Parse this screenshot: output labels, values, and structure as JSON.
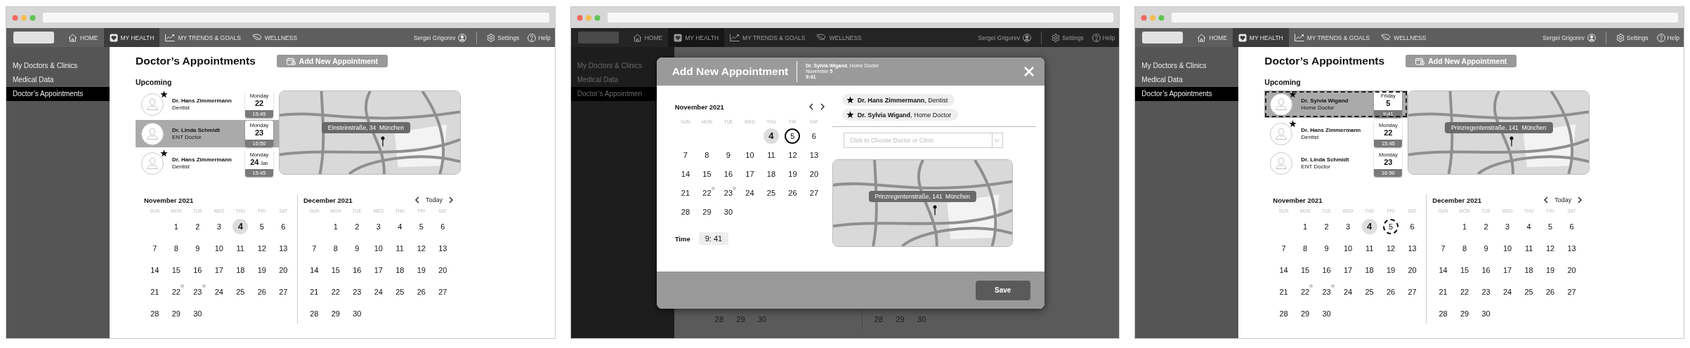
{
  "screens": [
    {
      "kind": "main",
      "dimmed": false,
      "nav": {
        "items": [
          {
            "label": "HOME",
            "selected": false
          },
          {
            "label": "MY HEALTH",
            "selected": true
          },
          {
            "label": "MY TRENDS & GOALS",
            "selected": false
          },
          {
            "label": "WELLNESS",
            "selected": false
          }
        ],
        "user": "Sergei Grigorev",
        "settings": "Settings",
        "help": "Help"
      },
      "sidebar": {
        "items": [
          {
            "label": "My Doctors & Clinics",
            "selected": false
          },
          {
            "label": "Medical Data",
            "selected": false
          },
          {
            "label": "Doctor’s Appointments",
            "selected": true
          }
        ]
      },
      "content": {
        "title": "Doctor’s Appointments",
        "add_button": "Add New Appointment",
        "upcoming_label": "Upcoming",
        "appointments": [
          {
            "name": "Dr. Hans Zimmermann",
            "specialty": "Dentist",
            "weekday": "Monday",
            "day": "22",
            "time": "15:45",
            "starred": true,
            "selected": false,
            "tentative": false
          },
          {
            "name": "Dr. Linda Schmidt",
            "specialty": "ENT Doctor",
            "weekday": "Monday",
            "day": "23",
            "time": "16:50",
            "starred": false,
            "selected": true,
            "tentative": false
          },
          {
            "name": "Dr. Hans Zimmermann",
            "specialty": "Dentist",
            "weekday": "Monday",
            "day": "24",
            "month": "Jan",
            "time": "15:45",
            "starred": true,
            "selected": false,
            "tentative": false
          }
        ],
        "map": {
          "address": "Einsteinstraße, 34  München"
        },
        "today_button": "Today",
        "calendars": [
          {
            "title": "November 2021",
            "weekdays": [
              "SUN",
              "MON",
              "TUE",
              "WED",
              "THU",
              "FRI",
              "SAT"
            ],
            "weeks": [
              {
                "days": [
                  {
                    "label": "1",
                    "today": false,
                    "event": false,
                    "selected": false
                  },
                  {
                    "label": "2",
                    "today": false,
                    "event": false,
                    "selected": false
                  },
                  {
                    "label": "3",
                    "today": false,
                    "event": false,
                    "selected": false
                  },
                  {
                    "label": "4",
                    "today": true,
                    "event": false,
                    "selected": false
                  },
                  {
                    "label": "5",
                    "today": false,
                    "event": false,
                    "selected": false
                  },
                  {
                    "label": "6",
                    "today": false,
                    "event": false,
                    "selected": false
                  }
                ]
              },
              {
                "days": [
                  {
                    "label": "7",
                    "today": false,
                    "event": false,
                    "selected": false
                  },
                  {
                    "label": "8",
                    "today": false,
                    "event": false,
                    "selected": false
                  },
                  {
                    "label": "9",
                    "today": false,
                    "event": false,
                    "selected": false
                  },
                  {
                    "label": "10",
                    "today": false,
                    "event": false,
                    "selected": false
                  },
                  {
                    "label": "11",
                    "today": false,
                    "event": false,
                    "selected": false
                  },
                  {
                    "label": "12",
                    "today": false,
                    "event": false,
                    "selected": false
                  },
                  {
                    "label": "13",
                    "today": false,
                    "event": false,
                    "selected": false
                  }
                ]
              },
              {
                "days": [
                  {
                    "label": "14",
                    "today": false,
                    "event": false,
                    "selected": false
                  },
                  {
                    "label": "15",
                    "today": false,
                    "event": false,
                    "selected": false
                  },
                  {
                    "label": "16",
                    "today": false,
                    "event": false,
                    "selected": false
                  },
                  {
                    "label": "17",
                    "today": false,
                    "event": false,
                    "selected": false
                  },
                  {
                    "label": "18",
                    "today": false,
                    "event": false,
                    "selected": false
                  },
                  {
                    "label": "19",
                    "today": false,
                    "event": false,
                    "selected": false
                  },
                  {
                    "label": "20",
                    "today": false,
                    "event": false,
                    "selected": false
                  }
                ]
              },
              {
                "days": [
                  {
                    "label": "21",
                    "today": false,
                    "event": false,
                    "selected": false
                  },
                  {
                    "label": "22",
                    "today": false,
                    "event": true,
                    "selected": false
                  },
                  {
                    "label": "23",
                    "today": false,
                    "event": true,
                    "selected": false
                  },
                  {
                    "label": "24",
                    "today": false,
                    "event": false,
                    "selected": false
                  },
                  {
                    "label": "25",
                    "today": false,
                    "event": false,
                    "selected": false
                  },
                  {
                    "label": "26",
                    "today": false,
                    "event": false,
                    "selected": false
                  },
                  {
                    "label": "27",
                    "today": false,
                    "event": false,
                    "selected": false
                  }
                ]
              },
              {
                "days": [
                  {
                    "label": "28",
                    "today": false,
                    "event": false,
                    "selected": false
                  },
                  {
                    "label": "29",
                    "today": false,
                    "event": false,
                    "selected": false
                  },
                  {
                    "label": "30",
                    "today": false,
                    "event": false,
                    "selected": false
                  }
                ]
              }
            ]
          },
          {
            "title": "December 2021",
            "weekdays": [
              "SUN",
              "MON",
              "TUE",
              "WED",
              "THU",
              "FRI",
              "SAT"
            ],
            "weeks": [
              {
                "days": [
                  {
                    "label": "1",
                    "today": false,
                    "event": false,
                    "selected": false
                  },
                  {
                    "label": "2",
                    "today": false,
                    "event": false,
                    "selected": false
                  },
                  {
                    "label": "3",
                    "today": false,
                    "event": false,
                    "selected": false
                  },
                  {
                    "label": "4",
                    "today": false,
                    "event": false,
                    "selected": false
                  },
                  {
                    "label": "5",
                    "today": false,
                    "event": false,
                    "selected": false
                  },
                  {
                    "label": "6",
                    "today": false,
                    "event": false,
                    "selected": false
                  }
                ]
              },
              {
                "days": [
                  {
                    "label": "7",
                    "today": false,
                    "event": false,
                    "selected": false
                  },
                  {
                    "label": "8",
                    "today": false,
                    "event": false,
                    "selected": false
                  },
                  {
                    "label": "9",
                    "today": false,
                    "event": false,
                    "selected": false
                  },
                  {
                    "label": "10",
                    "today": false,
                    "event": false,
                    "selected": false
                  },
                  {
                    "label": "11",
                    "today": false,
                    "event": false,
                    "selected": false
                  },
                  {
                    "label": "12",
                    "today": false,
                    "event": false,
                    "selected": false
                  },
                  {
                    "label": "13",
                    "today": false,
                    "event": false,
                    "selected": false
                  }
                ]
              },
              {
                "days": [
                  {
                    "label": "14",
                    "today": false,
                    "event": false,
                    "selected": false
                  },
                  {
                    "label": "15",
                    "today": false,
                    "event": false,
                    "selected": false
                  },
                  {
                    "label": "16",
                    "today": false,
                    "event": false,
                    "selected": false
                  },
                  {
                    "label": "17",
                    "today": false,
                    "event": false,
                    "selected": false
                  },
                  {
                    "label": "18",
                    "today": false,
                    "event": false,
                    "selected": false
                  },
                  {
                    "label": "19",
                    "today": false,
                    "event": false,
                    "selected": false
                  },
                  {
                    "label": "20",
                    "today": false,
                    "event": false,
                    "selected": false
                  }
                ]
              },
              {
                "days": [
                  {
                    "label": "21",
                    "today": false,
                    "event": false,
                    "selected": false
                  },
                  {
                    "label": "22",
                    "today": false,
                    "event": false,
                    "selected": false
                  },
                  {
                    "label": "23",
                    "today": false,
                    "event": false,
                    "selected": false
                  },
                  {
                    "label": "24",
                    "today": false,
                    "event": false,
                    "selected": false
                  },
                  {
                    "label": "25",
                    "today": false,
                    "event": false,
                    "selected": false
                  },
                  {
                    "label": "26",
                    "today": false,
                    "event": false,
                    "selected": false
                  },
                  {
                    "label": "27",
                    "today": false,
                    "event": false,
                    "selected": false
                  }
                ]
              },
              {
                "days": [
                  {
                    "label": "28",
                    "today": false,
                    "event": false,
                    "selected": false
                  },
                  {
                    "label": "29",
                    "today": false,
                    "event": false,
                    "selected": false
                  },
                  {
                    "label": "30",
                    "today": false,
                    "event": false,
                    "selected": false
                  }
                ]
              }
            ]
          }
        ]
      }
    },
    {
      "kind": "modal",
      "dimmed": true,
      "nav": {
        "items": [
          {
            "label": "HOME",
            "selected": false
          },
          {
            "label": "MY HEALTH",
            "selected": true
          },
          {
            "label": "MY TRENDS & GOALS",
            "selected": false
          },
          {
            "label": "WELLNESS",
            "selected": false
          }
        ],
        "user": "Sergei Grigorev",
        "settings": "Settings",
        "help": "Help"
      },
      "sidebar": {
        "items": [
          {
            "label": "My Doctors & Clinics",
            "selected": false
          },
          {
            "label": "Medical Data",
            "selected": false
          },
          {
            "label": "Doctor’s Appointmen",
            "selected": true
          }
        ]
      },
      "background": {
        "calendar_rows": [
          [
            "28",
            "29",
            "30"
          ],
          [
            "28",
            "29",
            "30"
          ]
        ]
      },
      "modal": {
        "title": "Add New Appointment",
        "summary": {
          "doctor": "**Dr. Sylvia Wigand**, Home Doctor",
          "date": "November **5**",
          "time": "9:41"
        },
        "calendar": {
          "title": "November 2021",
          "tentative_selection": false,
          "weekdays": [
            "SUN",
            "MON",
            "TUE",
            "WED",
            "THU",
            "FRI",
            "SAT"
          ],
          "weeks": [
            {
              "days": [
                {
                  "label": "4",
                  "today": true,
                  "event": false,
                  "selected": false
                },
                {
                  "label": "5",
                  "today": false,
                  "event": false,
                  "selected": true
                },
                {
                  "label": "6",
                  "today": false,
                  "event": false,
                  "selected": false
                }
              ]
            },
            {
              "days": [
                {
                  "label": "7",
                  "today": false,
                  "event": false,
                  "selected": false
                },
                {
                  "label": "8",
                  "today": false,
                  "event": false,
                  "selected": false
                },
                {
                  "label": "9",
                  "today": false,
                  "event": false,
                  "selected": false
                },
                {
                  "label": "10",
                  "today": false,
                  "event": false,
                  "selected": false
                },
                {
                  "label": "11",
                  "today": false,
                  "event": false,
                  "selected": false
                },
                {
                  "label": "12",
                  "today": false,
                  "event": false,
                  "selected": false
                },
                {
                  "label": "13",
                  "today": false,
                  "event": false,
                  "selected": false
                }
              ]
            },
            {
              "days": [
                {
                  "label": "14",
                  "today": false,
                  "event": false,
                  "selected": false
                },
                {
                  "label": "15",
                  "today": false,
                  "event": false,
                  "selected": false
                },
                {
                  "label": "16",
                  "today": false,
                  "event": false,
                  "selected": false
                },
                {
                  "label": "17",
                  "today": false,
                  "event": false,
                  "selected": false
                },
                {
                  "label": "18",
                  "today": false,
                  "event": false,
                  "selected": false
                },
                {
                  "label": "19",
                  "today": false,
                  "event": false,
                  "selected": false
                },
                {
                  "label": "20",
                  "today": false,
                  "event": false,
                  "selected": false
                }
              ]
            },
            {
              "days": [
                {
                  "label": "21",
                  "today": false,
                  "event": false,
                  "selected": false
                },
                {
                  "label": "22",
                  "today": false,
                  "event": true,
                  "selected": false
                },
                {
                  "label": "23",
                  "today": false,
                  "event": true,
                  "selected": false
                },
                {
                  "label": "24",
                  "today": false,
                  "event": false,
                  "selected": false
                },
                {
                  "label": "25",
                  "today": false,
                  "event": false,
                  "selected": false
                },
                {
                  "label": "26",
                  "today": false,
                  "event": false,
                  "selected": false
                },
                {
                  "label": "27",
                  "today": false,
                  "event": false,
                  "selected": false
                }
              ]
            },
            {
              "days": [
                {
                  "label": "28",
                  "today": false,
                  "event": false,
                  "selected": false
                },
                {
                  "label": "29",
                  "today": false,
                  "event": false,
                  "selected": false
                },
                {
                  "label": "30",
                  "today": false,
                  "event": false,
                  "selected": false
                }
              ]
            }
          ]
        },
        "time": {
          "label": "Time",
          "value": "9: 41"
        },
        "chips": [
          {
            "text": "**Dr. Hans Zimmermann**, Dentist",
            "starred": true
          },
          {
            "text": "**Dr. Sylvia Wigand**, Home Doctor",
            "starred": true
          }
        ],
        "dropdown": {
          "placeholder": "Click to Choose Doctor or Clinic"
        },
        "map": {
          "address": "Prinzregentenstraße, 141  München"
        },
        "save_button": "Save"
      }
    },
    {
      "kind": "main",
      "dimmed": false,
      "nav": {
        "items": [
          {
            "label": "HOME",
            "selected": false
          },
          {
            "label": "MY HEALTH",
            "selected": true
          },
          {
            "label": "MY TRENDS & GOALS",
            "selected": false
          },
          {
            "label": "WELLNESS",
            "selected": false
          }
        ],
        "user": "Sergei Grigorev",
        "settings": "Settings",
        "help": "Help"
      },
      "sidebar": {
        "items": [
          {
            "label": "My Doctors & Clinics",
            "selected": false
          },
          {
            "label": "Medical Data",
            "selected": false
          },
          {
            "label": "Doctor’s Appointments",
            "selected": true
          }
        ]
      },
      "content": {
        "title": "Doctor’s Appointments",
        "add_button": "Add New Appointment",
        "upcoming_label": "Upcoming",
        "appointments": [
          {
            "name": "Dr. Sylvia Wigand",
            "specialty": "Home Doctor",
            "weekday": "Friday",
            "day": "5",
            "time": "9:41",
            "starred": true,
            "selected": true,
            "tentative": true
          },
          {
            "name": "Dr. Hans Zimmermann",
            "specialty": "Dentist",
            "weekday": "Monday",
            "day": "22",
            "time": "15:45",
            "starred": true,
            "selected": false,
            "tentative": false
          },
          {
            "name": "Dr. Linda Schmidt",
            "specialty": "ENT Doctor",
            "weekday": "Monday",
            "day": "23",
            "time": "16:50",
            "starred": false,
            "selected": false,
            "tentative": false
          }
        ],
        "map": {
          "address": "Prinzregentenstraße, 141  München"
        },
        "today_button": "Today",
        "calendars": [
          {
            "title": "November 2021",
            "tentative_selection": true,
            "weekdays": [
              "SUN",
              "MON",
              "TUE",
              "WED",
              "THU",
              "FRI",
              "SAT"
            ],
            "weeks": [
              {
                "days": [
                  {
                    "label": "1",
                    "today": false,
                    "event": false,
                    "selected": false
                  },
                  {
                    "label": "2",
                    "today": false,
                    "event": false,
                    "selected": false
                  },
                  {
                    "label": "3",
                    "today": false,
                    "event": false,
                    "selected": false
                  },
                  {
                    "label": "4",
                    "today": true,
                    "event": false,
                    "selected": false
                  },
                  {
                    "label": "5",
                    "today": false,
                    "event": false,
                    "selected": true
                  },
                  {
                    "label": "6",
                    "today": false,
                    "event": false,
                    "selected": false
                  }
                ]
              },
              {
                "days": [
                  {
                    "label": "7",
                    "today": false,
                    "event": false,
                    "selected": false
                  },
                  {
                    "label": "8",
                    "today": false,
                    "event": false,
                    "selected": false
                  },
                  {
                    "label": "9",
                    "today": false,
                    "event": false,
                    "selected": false
                  },
                  {
                    "label": "10",
                    "today": false,
                    "event": false,
                    "selected": false
                  },
                  {
                    "label": "11",
                    "today": false,
                    "event": false,
                    "selected": false
                  },
                  {
                    "label": "12",
                    "today": false,
                    "event": false,
                    "selected": false
                  },
                  {
                    "label": "13",
                    "today": false,
                    "event": false,
                    "selected": false
                  }
                ]
              },
              {
                "days": [
                  {
                    "label": "14",
                    "today": false,
                    "event": false,
                    "selected": false
                  },
                  {
                    "label": "15",
                    "today": false,
                    "event": false,
                    "selected": false
                  },
                  {
                    "label": "16",
                    "today": false,
                    "event": false,
                    "selected": false
                  },
                  {
                    "label": "17",
                    "today": false,
                    "event": false,
                    "selected": false
                  },
                  {
                    "label": "18",
                    "today": false,
                    "event": false,
                    "selected": false
                  },
                  {
                    "label": "19",
                    "today": false,
                    "event": false,
                    "selected": false
                  },
                  {
                    "label": "20",
                    "today": false,
                    "event": false,
                    "selected": false
                  }
                ]
              },
              {
                "days": [
                  {
                    "label": "21",
                    "today": false,
                    "event": false,
                    "selected": false
                  },
                  {
                    "label": "22",
                    "today": false,
                    "event": true,
                    "selected": false
                  },
                  {
                    "label": "23",
                    "today": false,
                    "event": true,
                    "selected": false
                  },
                  {
                    "label": "24",
                    "today": false,
                    "event": false,
                    "selected": false
                  },
                  {
                    "label": "25",
                    "today": false,
                    "event": false,
                    "selected": false
                  },
                  {
                    "label": "26",
                    "today": false,
                    "event": false,
                    "selected": false
                  },
                  {
                    "label": "27",
                    "today": false,
                    "event": false,
                    "selected": false
                  }
                ]
              },
              {
                "days": [
                  {
                    "label": "28",
                    "today": false,
                    "event": false,
                    "selected": false
                  },
                  {
                    "label": "29",
                    "today": false,
                    "event": false,
                    "selected": false
                  },
                  {
                    "label": "30",
                    "today": false,
                    "event": false,
                    "selected": false
                  }
                ]
              }
            ]
          },
          {
            "title": "December 2021",
            "weekdays": [
              "SUN",
              "MON",
              "TUE",
              "WED",
              "THU",
              "FRI",
              "SAT"
            ],
            "weeks": [
              {
                "days": [
                  {
                    "label": "1",
                    "today": false,
                    "event": false,
                    "selected": false
                  },
                  {
                    "label": "2",
                    "today": false,
                    "event": false,
                    "selected": false
                  },
                  {
                    "label": "3",
                    "today": false,
                    "event": false,
                    "selected": false
                  },
                  {
                    "label": "4",
                    "today": false,
                    "event": false,
                    "selected": false
                  },
                  {
                    "label": "5",
                    "today": false,
                    "event": false,
                    "selected": false
                  },
                  {
                    "label": "6",
                    "today": false,
                    "event": false,
                    "selected": false
                  }
                ]
              },
              {
                "days": [
                  {
                    "label": "7",
                    "today": false,
                    "event": false,
                    "selected": false
                  },
                  {
                    "label": "8",
                    "today": false,
                    "event": false,
                    "selected": false
                  },
                  {
                    "label": "9",
                    "today": false,
                    "event": false,
                    "selected": false
                  },
                  {
                    "label": "10",
                    "today": false,
                    "event": false,
                    "selected": false
                  },
                  {
                    "label": "11",
                    "today": false,
                    "event": false,
                    "selected": false
                  },
                  {
                    "label": "12",
                    "today": false,
                    "event": false,
                    "selected": false
                  },
                  {
                    "label": "13",
                    "today": false,
                    "event": false,
                    "selected": false
                  }
                ]
              },
              {
                "days": [
                  {
                    "label": "14",
                    "today": false,
                    "event": false,
                    "selected": false
                  },
                  {
                    "label": "15",
                    "today": false,
                    "event": false,
                    "selected": false
                  },
                  {
                    "label": "16",
                    "today": false,
                    "event": false,
                    "selected": false
                  },
                  {
                    "label": "17",
                    "today": false,
                    "event": false,
                    "selected": false
                  },
                  {
                    "label": "18",
                    "today": false,
                    "event": false,
                    "selected": false
                  },
                  {
                    "label": "19",
                    "today": false,
                    "event": false,
                    "selected": false
                  },
                  {
                    "label": "20",
                    "today": false,
                    "event": false,
                    "selected": false
                  }
                ]
              },
              {
                "days": [
                  {
                    "label": "21",
                    "today": false,
                    "event": false,
                    "selected": false
                  },
                  {
                    "label": "22",
                    "today": false,
                    "event": false,
                    "selected": false
                  },
                  {
                    "label": "23",
                    "today": false,
                    "event": false,
                    "selected": false
                  },
                  {
                    "label": "24",
                    "today": false,
                    "event": false,
                    "selected": false
                  },
                  {
                    "label": "25",
                    "today": false,
                    "event": false,
                    "selected": false
                  },
                  {
                    "label": "26",
                    "today": false,
                    "event": false,
                    "selected": false
                  },
                  {
                    "label": "27",
                    "today": false,
                    "event": false,
                    "selected": false
                  }
                ]
              },
              {
                "days": [
                  {
                    "label": "28",
                    "today": false,
                    "event": false,
                    "selected": false
                  },
                  {
                    "label": "29",
                    "today": false,
                    "event": false,
                    "selected": false
                  },
                  {
                    "label": "30",
                    "today": false,
                    "event": false,
                    "selected": false
                  }
                ]
              }
            ]
          }
        ]
      }
    }
  ]
}
